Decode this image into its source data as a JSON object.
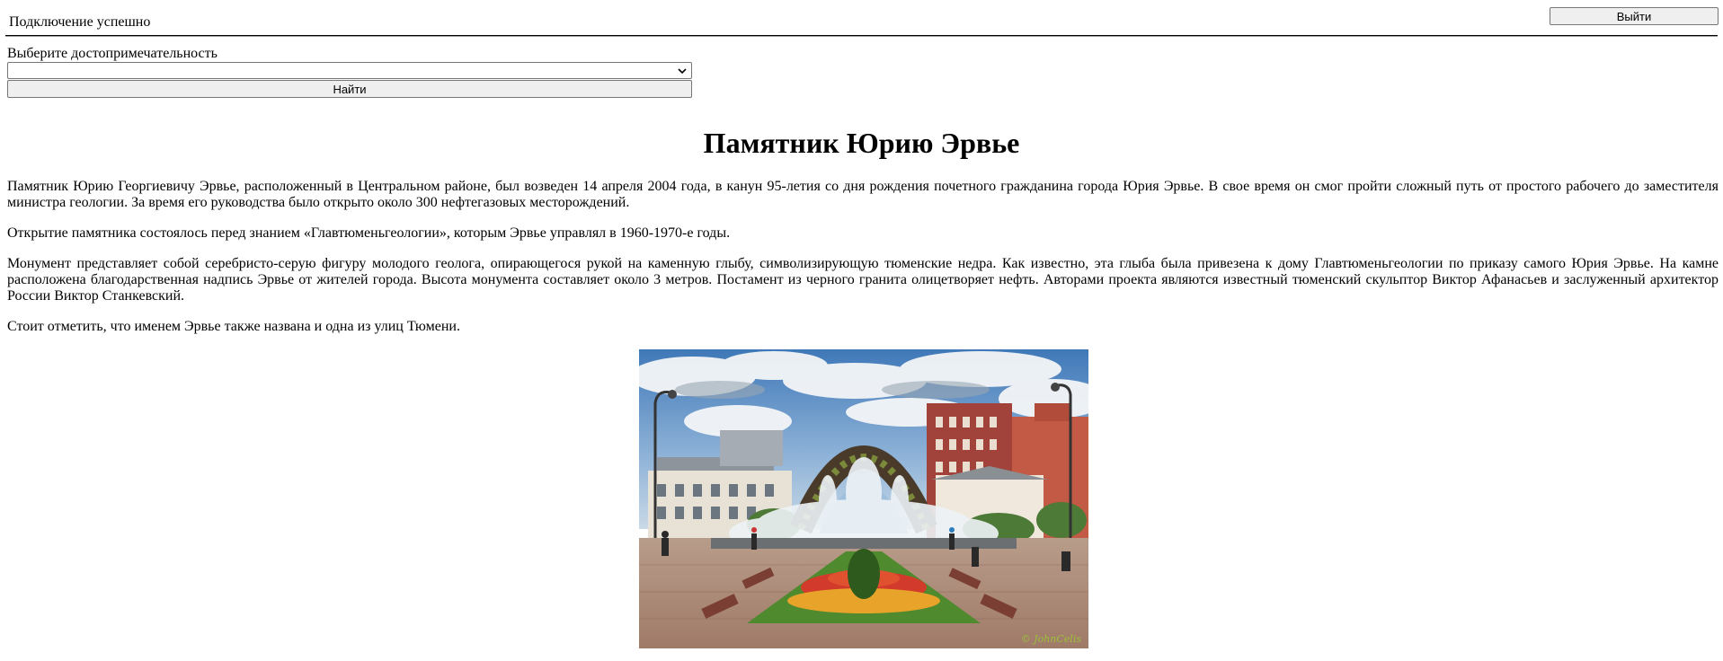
{
  "header": {
    "status_text": "Подключение успешно",
    "logout_label": "Выйти"
  },
  "form": {
    "select_label": "Выберите достопримечательность",
    "select_value": "",
    "find_label": "Найти"
  },
  "article": {
    "title": "Памятник Юрию Эрвье",
    "paragraphs": [
      "Памятник Юрию Георгиевичу Эрвье, расположенный в Центральном районе, был возведен 14 апреля 2004 года, в канун 95-летия со дня рождения почетного гражданина города Юрия Эрвье. В свое время он смог пройти сложный путь от простого рабочего до заместителя министра геологии. За время его руководства было открыто около 300 нефтегазовых месторождений.",
      "Открытие памятника состоялось перед знанием «Главтюменьгеологии», которым Эрвье управлял в 1960-1970-е годы.",
      "Монумент представляет собой серебристо-серую фигуру молодого геолога, опирающегося рукой на каменную глыбу, символизирующую тюменские недра. Как известно, эта глыба была привезена к дому Главтюменьгеологии по приказу самого Юрия Эрвье. На камне расположена благодарственная надпись Эрвье от жителей города. Высота монумента составляет около 3 метров. Постамент из черного гранита олицетворяет нефть. Авторами проекта являются известный тюменский скульптор Виктор Афанасьев и заслуженный архитектор России Виктор Станкевский.",
      "Стоит отметить, что именем Эрвье также названа и одна из улиц Тюмени."
    ],
    "photo_watermark": "© JohnCelis"
  },
  "colors": {
    "button_bg": "#efefef",
    "button_border": "#767676"
  }
}
